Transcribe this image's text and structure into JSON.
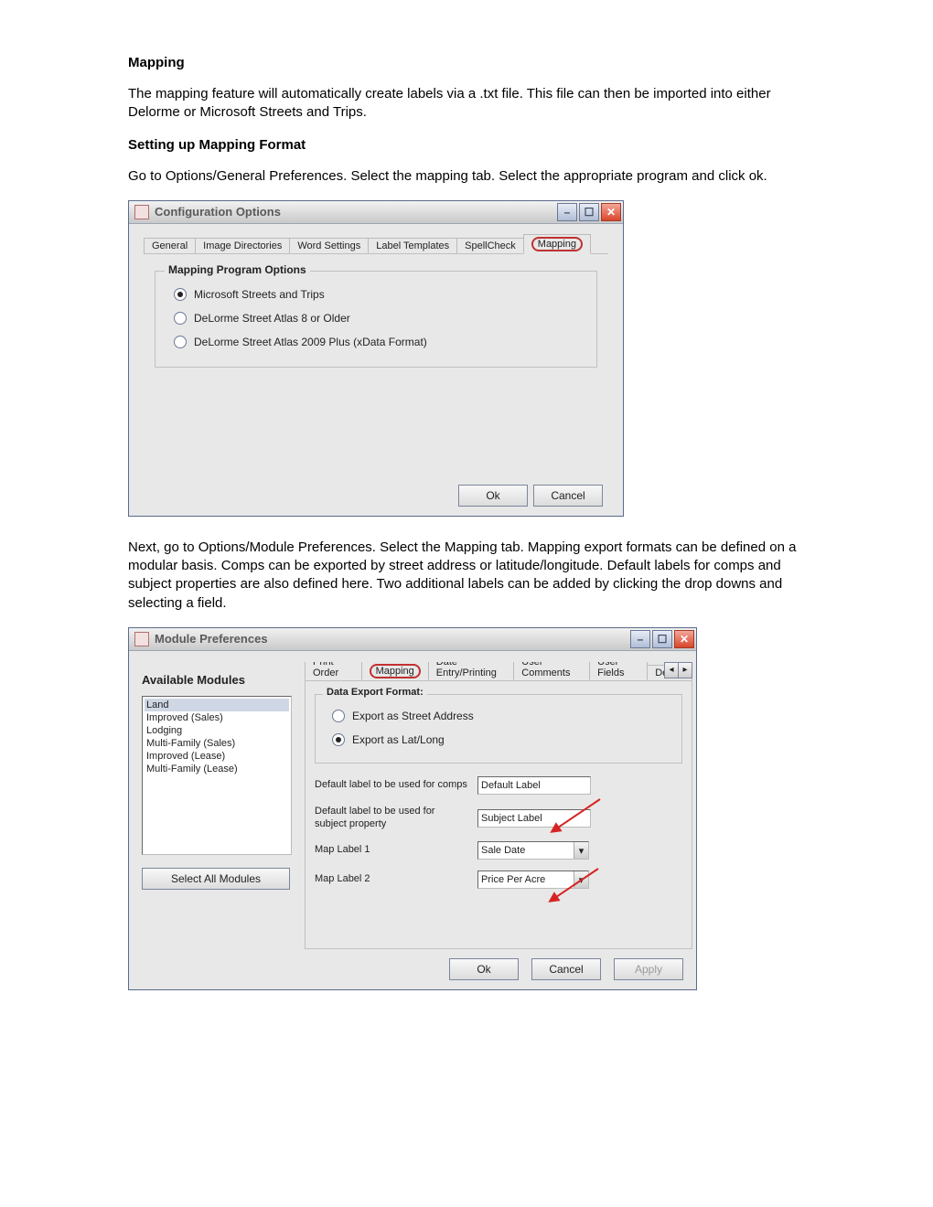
{
  "doc": {
    "h1": "Mapping",
    "p1": "The mapping feature will automatically create labels via a .txt file.  This file can then be imported into either Delorme or Microsoft Streets and Trips.",
    "h2": "Setting up Mapping Format",
    "p2": "Go to Options/General Preferences.  Select the mapping tab.  Select the appropriate program and click ok.",
    "p3": "Next, go to Options/Module Preferences.  Select the Mapping tab.  Mapping export formats can be defined on a modular basis.  Comps can be exported by street address or latitude/longitude.  Default labels for comps and subject properties are also defined here.  Two additional labels can be added by clicking the drop downs and selecting a field."
  },
  "win1": {
    "title": "Configuration Options",
    "tabs": [
      "General",
      "Image Directories",
      "Word Settings",
      "Label Templates",
      "SpellCheck",
      "Mapping"
    ],
    "active_tab": "Mapping",
    "group_legend": "Mapping Program Options",
    "options": [
      {
        "label": "Microsoft Streets and Trips",
        "checked": true
      },
      {
        "label": "DeLorme Street Atlas 8 or Older",
        "checked": false
      },
      {
        "label": "DeLorme Street Atlas 2009 Plus (xData Format)",
        "checked": false
      }
    ],
    "ok": "Ok",
    "cancel": "Cancel"
  },
  "win2": {
    "title": "Module Preferences",
    "available_modules_label": "Available Modules",
    "modules": [
      "Land",
      "Improved (Sales)",
      "Lodging",
      "Multi-Family (Sales)",
      "Improved (Lease)",
      "Multi-Family (Lease)"
    ],
    "selected_module": "Land",
    "select_all": "Select All Modules",
    "tabs": [
      "Print Order",
      "Mapping",
      "Date Entry/Printing",
      "User Comments",
      "User Fields",
      "Defaul"
    ],
    "active_tab": "Mapping",
    "tabscroll_left": "◂",
    "tabscroll_right": "▸",
    "export_legend": "Data Export Format:",
    "export_options": [
      {
        "label": "Export as Street Address",
        "checked": false
      },
      {
        "label": "Export as Lat/Long",
        "checked": true
      }
    ],
    "rows": {
      "comps_label": "Default label to be used for comps",
      "comps_value": "Default Label",
      "subject_label": "Default label to be used for subject property",
      "subject_value": "Subject Label",
      "ml1_label": "Map Label 1",
      "ml1_value": "Sale Date",
      "ml2_label": "Map Label 2",
      "ml2_value": "Price Per Acre"
    },
    "ok": "Ok",
    "cancel": "Cancel",
    "apply": "Apply"
  }
}
